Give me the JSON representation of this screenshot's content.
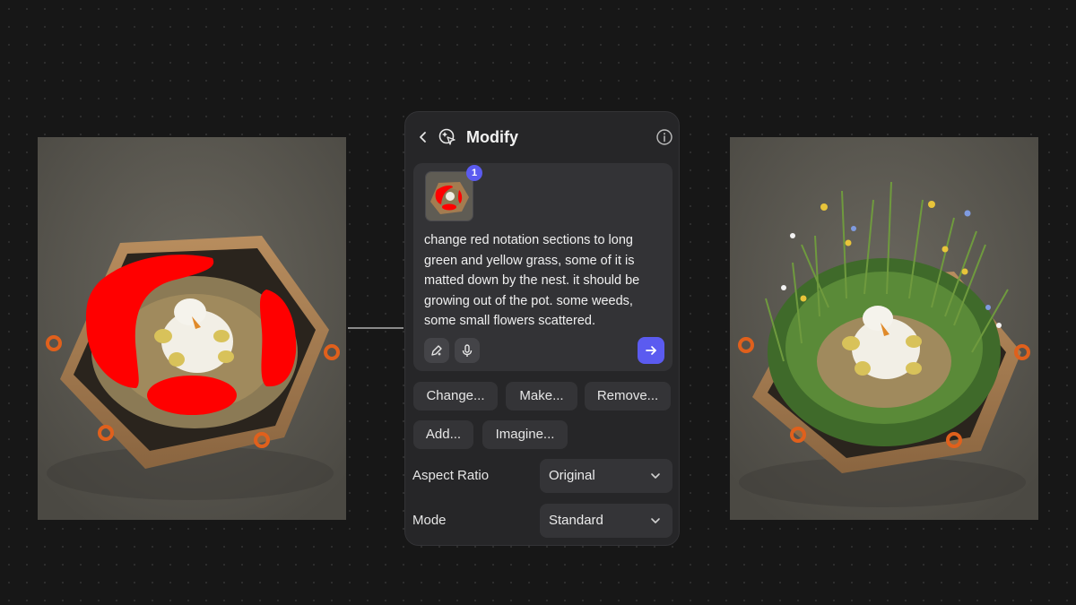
{
  "panel": {
    "title": "Modify",
    "icons": {
      "back": "chevron-left-icon",
      "modify": "cursor-sparkle-icon",
      "info": "info-icon"
    },
    "attachment_count": "1",
    "prompt_text": "change red notation sections to long green and yellow grass, some of it is matted down by the nest. it should be growing out of the pot. some weeds, some small flowers scattered.",
    "tools": {
      "draw": "pen-sparkle-icon",
      "mic": "microphone-icon",
      "send": "arrow-right-icon"
    },
    "actions": [
      "Change...",
      "Make...",
      "Remove...",
      "Add...",
      "Imagine..."
    ],
    "aspect_ratio": {
      "label": "Aspect Ratio",
      "value": "Original"
    },
    "mode": {
      "label": "Mode",
      "value": "Standard"
    }
  },
  "colors": {
    "accent": "#5b5bf0",
    "annotation_red": "#ff0000",
    "panel_bg": "#262628"
  }
}
